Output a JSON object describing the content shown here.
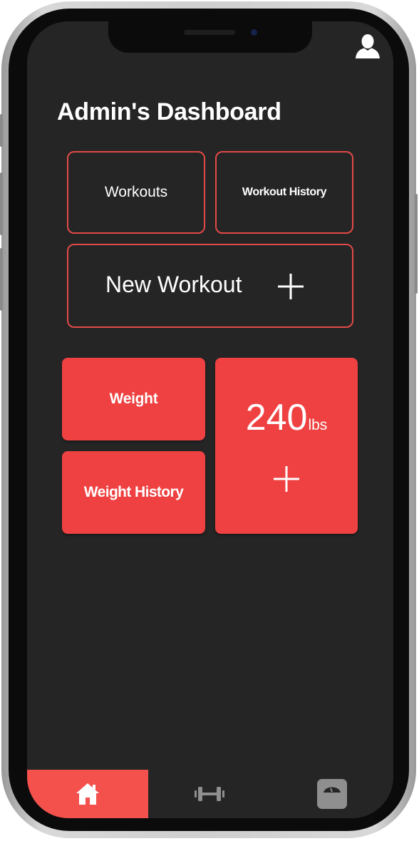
{
  "header": {
    "title": "Admin's Dashboard",
    "profile_icon": "user-profile-icon"
  },
  "workouts_section": {
    "workouts_label": "Workouts",
    "workout_history_label": "Workout History",
    "new_workout_label": "New Workout",
    "new_workout_icon": "plus-icon"
  },
  "weight_section": {
    "weight_label": "Weight",
    "weight_history_label": "Weight History",
    "current_weight_value": "240",
    "current_weight_unit": "lbs",
    "add_weight_icon": "plus-icon"
  },
  "bottom_nav": {
    "active_tab": "home",
    "items": [
      {
        "id": "home",
        "icon": "home-icon"
      },
      {
        "id": "workouts",
        "icon": "dumbbell-icon"
      },
      {
        "id": "weight",
        "icon": "scale-icon"
      }
    ]
  },
  "colors": {
    "background": "#252526",
    "accent": "#ef4141",
    "accent_outline": "#e24a47",
    "nav_active": "#f4504c",
    "text": "#ffffff",
    "inactive_icon": "#8f8f8f"
  }
}
